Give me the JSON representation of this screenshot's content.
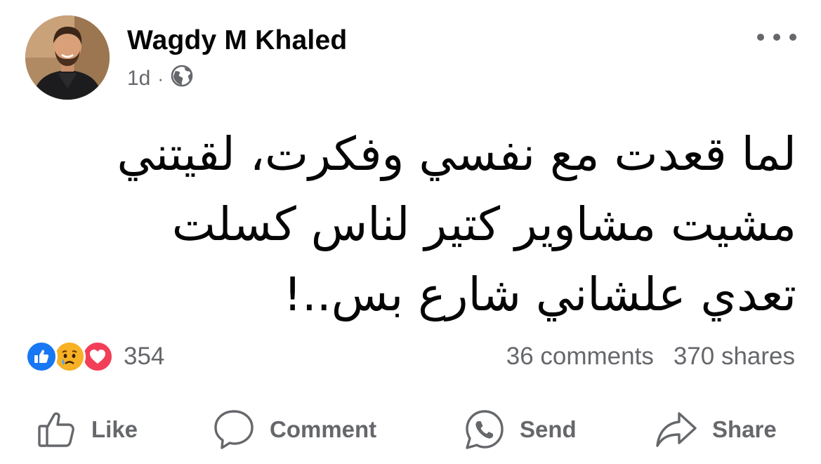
{
  "post": {
    "author": "Wagdy M Khaled",
    "time": "1d",
    "separator": "·",
    "audience_icon": "globe-icon",
    "more_icon": "more-horizontal-icon",
    "text_lines": [
      "لما قعدت مع نفسي وفكرت، لقيتني",
      "مشيت مشاوير كتير لناس كسلت",
      "تعدي علشاني شارع بس..!"
    ]
  },
  "reactions": {
    "icons": [
      "like-reaction-icon",
      "sad-reaction-icon",
      "love-reaction-icon"
    ],
    "count": "354",
    "comments": "36 comments",
    "shares": "370 shares"
  },
  "actions": {
    "like": "Like",
    "comment": "Comment",
    "send": "Send",
    "share": "Share"
  },
  "colors": {
    "text": "#050505",
    "secondary": "#65676b",
    "like_blue": "#1877f2",
    "sad_yellow": "#f7b125",
    "love_red": "#f33e58"
  }
}
